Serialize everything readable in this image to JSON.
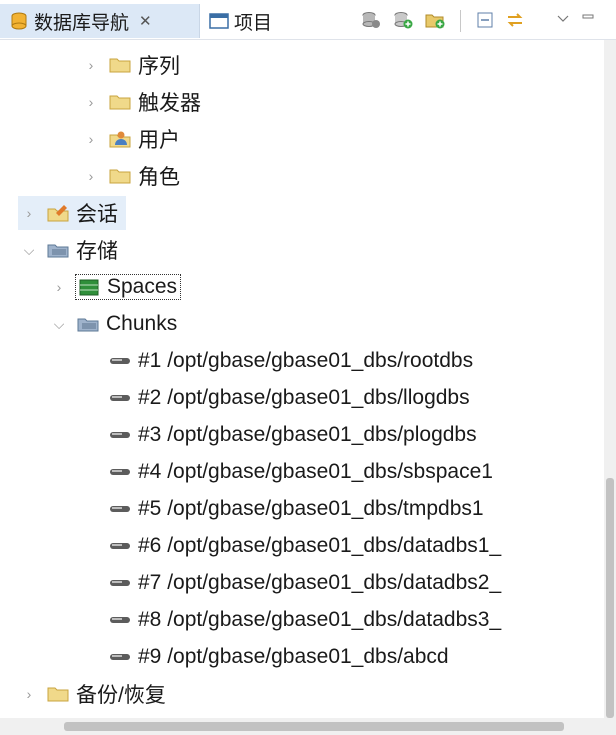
{
  "tabs": {
    "db_nav_label": "数据库导航",
    "db_nav_close": "✕",
    "project_label": "项目"
  },
  "tree": {
    "sequences": "序列",
    "triggers": "触发器",
    "users": "用户",
    "roles": "角色",
    "sessions": "会话",
    "storage": "存储",
    "spaces": "Spaces",
    "chunks": "Chunks",
    "chunk_items": [
      "#1 /opt/gbase/gbase01_dbs/rootdbs",
      "#2 /opt/gbase/gbase01_dbs/llogdbs",
      "#3 /opt/gbase/gbase01_dbs/plogdbs",
      "#4 /opt/gbase/gbase01_dbs/sbspace1",
      "#5 /opt/gbase/gbase01_dbs/tmpdbs1",
      "#6 /opt/gbase/gbase01_dbs/datadbs1_",
      "#7 /opt/gbase/gbase01_dbs/datadbs2_",
      "#8 /opt/gbase/gbase01_dbs/datadbs3_",
      "#9 /opt/gbase/gbase01_dbs/abcd"
    ],
    "backup_restore": "备份/恢复"
  },
  "icons": {
    "folder_color": "#e8c96a",
    "selection_color": "#dce8f6"
  }
}
